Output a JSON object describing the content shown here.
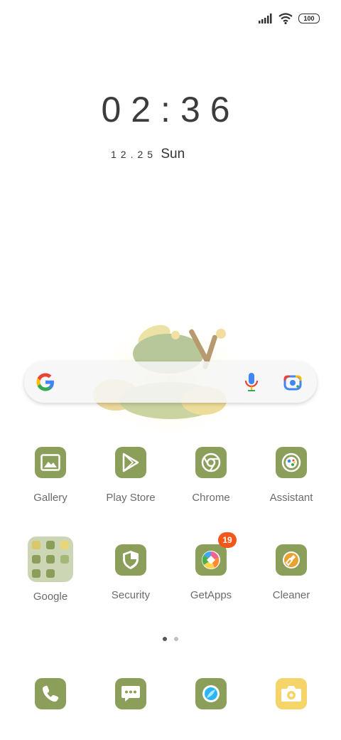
{
  "status_bar": {
    "battery": "100",
    "signal_icon": "signal-icon",
    "wifi_icon": "wifi-icon"
  },
  "clock": {
    "time": "02:36",
    "date": "12.25",
    "weekday": "Sun"
  },
  "search_bar": {
    "icons": [
      "google-logo-icon",
      "microphone-icon",
      "lens-camera-icon"
    ]
  },
  "apps": [
    {
      "label": "Gallery",
      "icon": "gallery-icon"
    },
    {
      "label": "Play Store",
      "icon": "play-store-icon"
    },
    {
      "label": "Chrome",
      "icon": "chrome-icon"
    },
    {
      "label": "Assistant",
      "icon": "assistant-icon"
    },
    {
      "label": "Google",
      "icon": "folder-icon"
    },
    {
      "label": "Security",
      "icon": "security-shield-icon"
    },
    {
      "label": "GetApps",
      "icon": "getapps-icon",
      "badge": "19"
    },
    {
      "label": "Cleaner",
      "icon": "cleaner-brush-icon"
    }
  ],
  "dock": [
    {
      "icon": "phone-icon"
    },
    {
      "icon": "messages-icon"
    },
    {
      "icon": "browser-icon"
    },
    {
      "icon": "camera-icon"
    }
  ],
  "page_indicator": {
    "pages": 2,
    "active": 1
  },
  "colors": {
    "icon_green": "#8c9f5a",
    "folder_bg": "#cdd6b4",
    "badge": "#f1581a",
    "camera_yellow": "#f5d46a"
  }
}
